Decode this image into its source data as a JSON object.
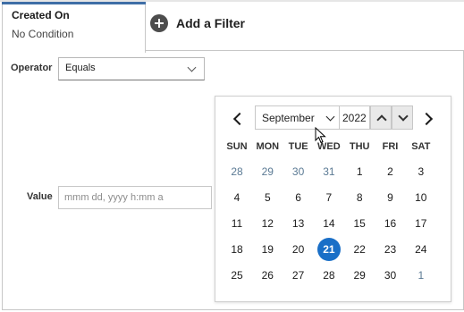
{
  "tab": {
    "title": "Created On",
    "subtitle": "No Condition"
  },
  "add_filter": {
    "label": "Add a Filter",
    "icon": "plus-circle-icon"
  },
  "operator": {
    "label": "Operator",
    "value": "Equals"
  },
  "value_field": {
    "label": "Value",
    "placeholder": "mmm dd, yyyy h:mm a"
  },
  "calendar": {
    "month": "September",
    "year": "2022",
    "weekdays": [
      "SUN",
      "MON",
      "TUE",
      "WED",
      "THU",
      "FRI",
      "SAT"
    ],
    "weeks": [
      [
        "28",
        "29",
        "30",
        "31",
        "1",
        "2",
        "3"
      ],
      [
        "4",
        "5",
        "6",
        "7",
        "8",
        "9",
        "10"
      ],
      [
        "11",
        "12",
        "13",
        "14",
        "15",
        "16",
        "17"
      ],
      [
        "18",
        "19",
        "20",
        "21",
        "22",
        "23",
        "24"
      ],
      [
        "25",
        "26",
        "27",
        "28",
        "29",
        "30",
        "1"
      ]
    ],
    "selected_day": "21"
  },
  "colors": {
    "accent": "#1a6fc7",
    "tab_accent": "#3f6ea6",
    "muted_day": "#5b7a94"
  }
}
